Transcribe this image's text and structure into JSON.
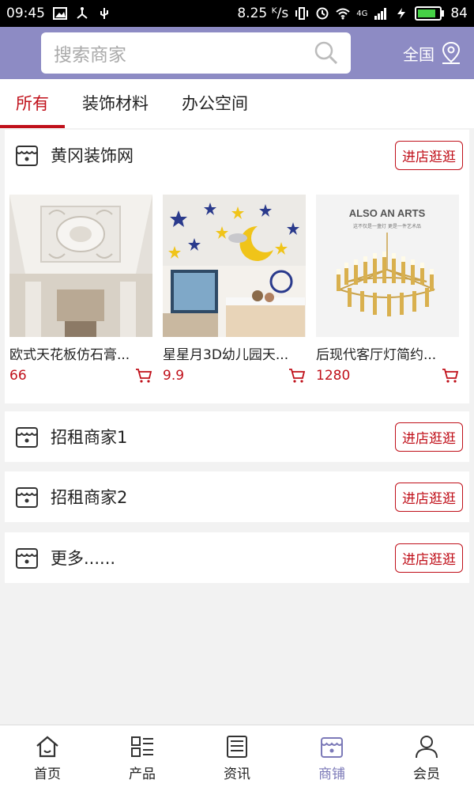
{
  "status_bar": {
    "time": "09:45",
    "speed": "8.25 ᴷ/s",
    "network": "4G",
    "battery": "84",
    "battery_level": 0.84
  },
  "header": {
    "search_placeholder": "搜索商家",
    "region": "全国"
  },
  "tabs": [
    {
      "label": "所有",
      "active": true
    },
    {
      "label": "装饰材料",
      "active": false
    },
    {
      "label": "办公空间",
      "active": false
    }
  ],
  "shops": [
    {
      "name": "黄冈装饰网",
      "enter_label": "进店逛逛",
      "products": [
        {
          "name": "欧式天花板仿石膏...",
          "price": "66"
        },
        {
          "name": "星星月3D幼儿园天...",
          "price": "9.9"
        },
        {
          "name": "后现代客厅灯简约...",
          "price": "1280"
        }
      ]
    },
    {
      "name": "招租商家1",
      "enter_label": "进店逛逛"
    },
    {
      "name": "招租商家2",
      "enter_label": "进店逛逛"
    },
    {
      "name": "更多......",
      "enter_label": "进店逛逛"
    }
  ],
  "product_image_texts": {
    "lamp_brand": "ALSO AN ARTS",
    "lamp_sub": "这不仅是一盏灯    更是一件艺术品"
  },
  "bottom_nav": [
    {
      "label": "首页",
      "icon": "home-icon",
      "active": false
    },
    {
      "label": "产品",
      "icon": "grid-list-icon",
      "active": false
    },
    {
      "label": "资讯",
      "icon": "news-icon",
      "active": false
    },
    {
      "label": "商铺",
      "icon": "shop-icon",
      "active": true
    },
    {
      "label": "会员",
      "icon": "user-icon",
      "active": false
    }
  ],
  "colors": {
    "header_bg": "#8d8bc4",
    "accent_red": "#c0101a",
    "nav_active": "#7c7ab8"
  }
}
